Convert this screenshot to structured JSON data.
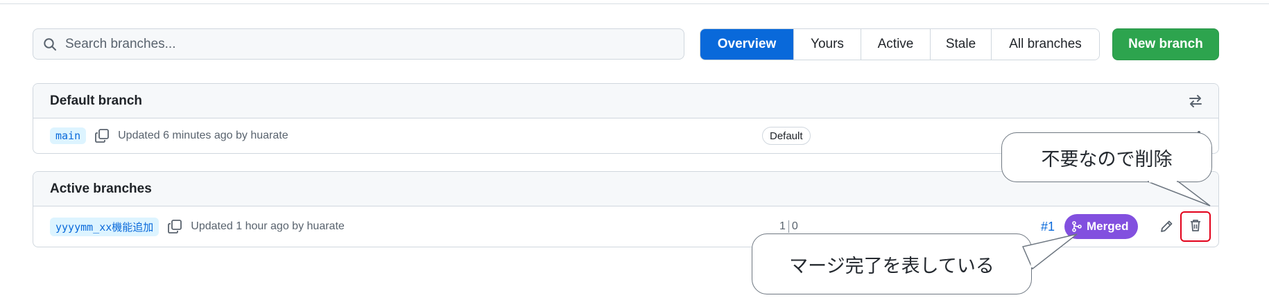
{
  "search": {
    "placeholder": "Search branches..."
  },
  "tabs": [
    {
      "label": "Overview",
      "active": true
    },
    {
      "label": "Yours",
      "active": false
    },
    {
      "label": "Active",
      "active": false
    },
    {
      "label": "Stale",
      "active": false
    },
    {
      "label": "All branches",
      "active": false
    }
  ],
  "new_branch_label": "New branch",
  "default_section": {
    "title": "Default branch",
    "branch": {
      "name": "main",
      "updated": "Updated 6 minutes ago by huarate",
      "badge": "Default"
    }
  },
  "active_section": {
    "title": "Active branches",
    "branch": {
      "name": "yyyymm_xx機能追加",
      "updated": "Updated 1 hour ago by huarate",
      "ahead": "1",
      "behind": "0",
      "pr_number": "#1",
      "pr_status": "Merged"
    }
  },
  "annotations": {
    "delete_note": "不要なので削除",
    "merged_note": "マージ完了を表している"
  },
  "colors": {
    "accent": "#0969da",
    "new_branch": "#2da44e",
    "merged": "#8250df",
    "highlight": "#e2001a"
  },
  "icons": [
    "search-icon",
    "copy-icon",
    "switch-arrows-icon",
    "git-merge-icon",
    "pencil-icon",
    "trash-icon"
  ]
}
